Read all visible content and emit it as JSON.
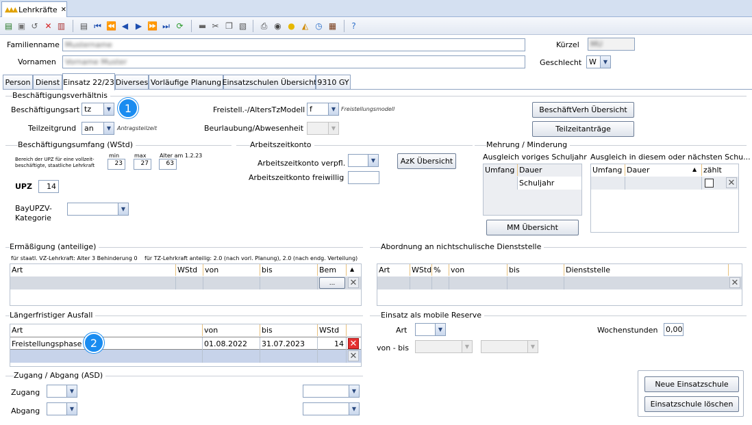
{
  "window_tab": {
    "title": "Lehrkräfte",
    "close": "✕"
  },
  "header": {
    "familienname_label": "Familienname",
    "familienname_value": "Mustername",
    "vornamen_label": "Vornamen",
    "vornamen_value": "Vorname Muster",
    "kuerzel_label": "Kürzel",
    "kuerzel_value": "MU",
    "geschlecht_label": "Geschlecht",
    "geschlecht_value": "W"
  },
  "tabs": [
    "Person",
    "Dienst",
    "Einsatz 22/23",
    "Diverses",
    "Vorläufige Planung",
    "Einsatzschulen Übersicht",
    "9310 GY"
  ],
  "beschaeftigung": {
    "title": "Beschäftigungsverhältnis",
    "art_label": "Beschäftigungsart",
    "art_value": "tz",
    "teilzeitgrund_label": "Teilzeitgrund",
    "teilzeitgrund_value": "an",
    "teilzeitgrund_hint": "Antragsteilzeit",
    "freistell_label": "Freistell.-/AltersTzModell",
    "freistell_value": "f",
    "freistell_hint": "Freistellungsmodell",
    "beurlaubung_label": "Beurlaubung/Abwesenheit",
    "btn_uebersicht": "BeschäftVerh Übersicht",
    "btn_teilzeit": "Teilzeitanträge"
  },
  "umfang": {
    "title": "Beschäftigungsumfang (WStd)",
    "bereich_text": "Bereich der UPZ für eine vollzeit-beschäftigte, staatliche Lehrkraft",
    "min_label": "min",
    "min_value": "23",
    "max_label": "max",
    "max_value": "27",
    "alter_label": "Alter am 1.2.23",
    "alter_value": "63",
    "upz_label": "UPZ",
    "upz_value": "14",
    "bayupzv_label": "BayUPZV-Kategorie"
  },
  "azk": {
    "title": "Arbeitszeitkonto",
    "verpfl_label": "Arbeitszeitkonto verpfl.",
    "frei_label": "Arbeitszeitkonto freiwillig",
    "btn": "AzK Übersicht"
  },
  "mehrung": {
    "title": "Mehrung / Minderung",
    "left_title": "Ausgleich voriges Schuljahr",
    "left_cols": [
      "Umfang",
      "Dauer"
    ],
    "left_row_dauer": "Schuljahr",
    "right_title": "Ausgleich in diesem oder nächsten Schu...",
    "right_cols": [
      "Umfang",
      "Dauer",
      "zählt"
    ],
    "btn": "MM Übersicht"
  },
  "ermaessigung": {
    "title": "Ermäßigung (anteilige)",
    "info_left": "für staatl. VZ-Lehrkraft: Alter 3 Behinderung 0",
    "info_right": "für TZ-Lehrkraft anteilig: 2.0 (nach vorl. Planung), 2.0 (nach endg. Verteilung)",
    "cols": [
      "Art",
      "WStd",
      "von",
      "bis",
      "Bem"
    ],
    "dots": "..."
  },
  "abordnung": {
    "title": "Abordnung an nichtschulische Dienststelle",
    "cols": [
      "Art",
      "WStd",
      "%",
      "von",
      "bis",
      "Dienststelle"
    ]
  },
  "ausfall": {
    "title": "Längerfristiger Ausfall",
    "cols": [
      "Art",
      "von",
      "bis",
      "WStd"
    ],
    "rows": [
      {
        "art": "Freistellungsphase",
        "von": "01.08.2022",
        "bis": "31.07.2023",
        "wstd": "14"
      }
    ]
  },
  "mobile": {
    "title": "Einsatz als mobile Reserve",
    "art_label": "Art",
    "vonbis_label": "von - bis",
    "wochenstunden_label": "Wochenstunden",
    "wochenstunden_value": "0,00"
  },
  "zugang": {
    "title": "Zugang / Abgang (ASD)",
    "zugang_label": "Zugang",
    "abgang_label": "Abgang"
  },
  "buttons": {
    "neue": "Neue Einsatzschule",
    "loeschen": "Einsatzschule löschen"
  },
  "badges": [
    "1",
    "2"
  ],
  "colors": {
    "accent": "#1a8cf0",
    "tabbar": "#d4e0f1",
    "delete": "#e53030"
  }
}
